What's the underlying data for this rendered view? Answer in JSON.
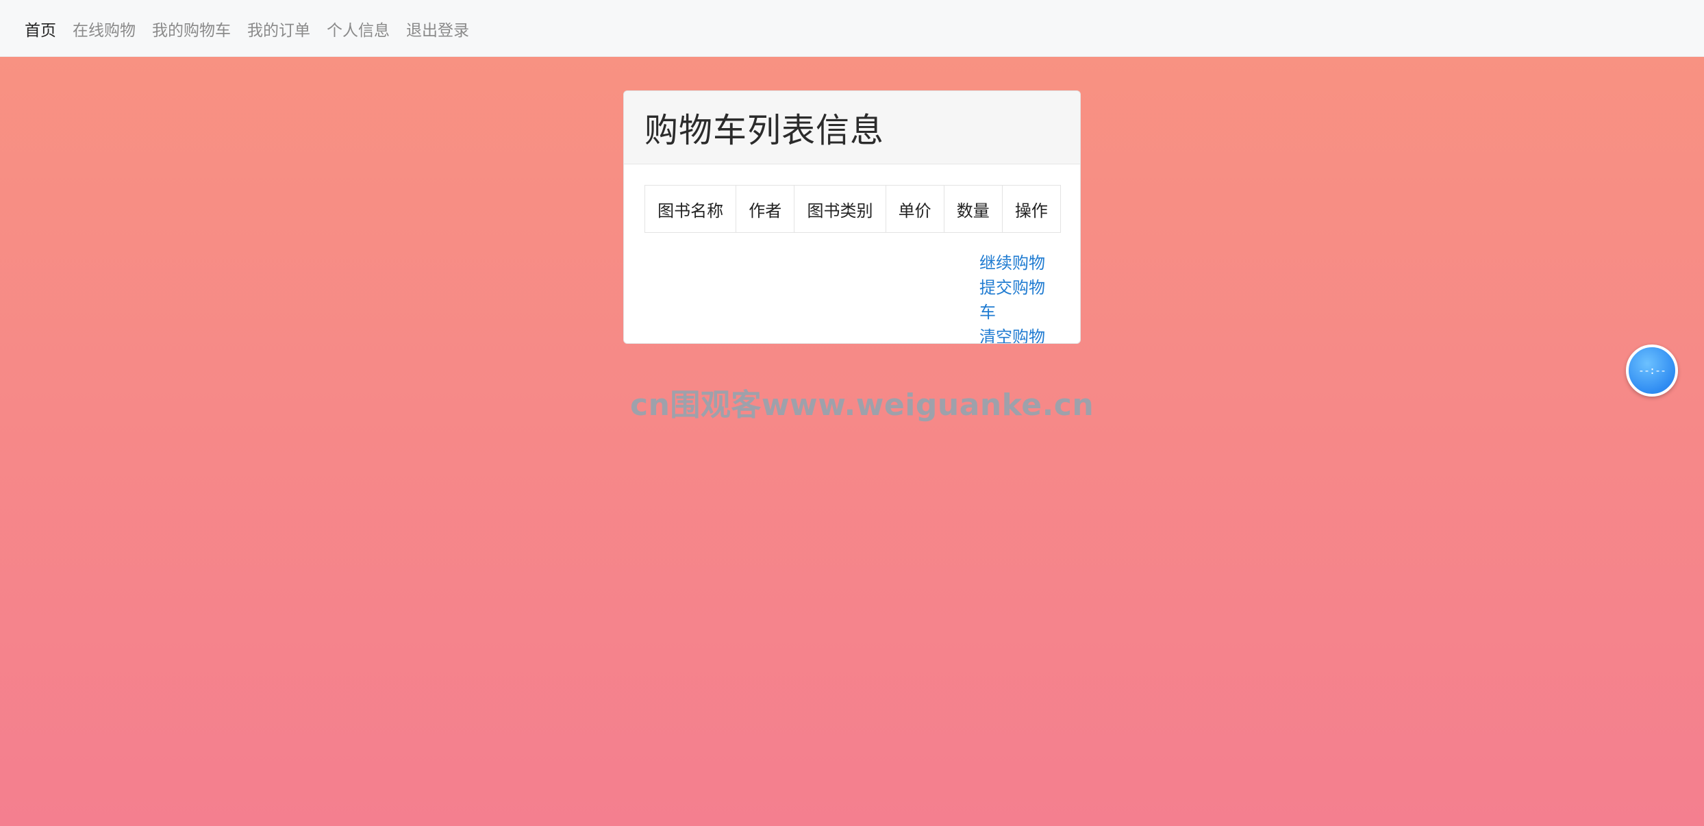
{
  "nav": {
    "items": [
      {
        "label": "首页",
        "active": true
      },
      {
        "label": "在线购物",
        "active": false
      },
      {
        "label": "我的购物车",
        "active": false
      },
      {
        "label": "我的订单",
        "active": false
      },
      {
        "label": "个人信息",
        "active": false
      },
      {
        "label": "退出登录",
        "active": false
      }
    ]
  },
  "card": {
    "title": "购物车列表信息",
    "table": {
      "columns": [
        "图书名称",
        "作者",
        "图书类别",
        "单价",
        "数量",
        "操作"
      ],
      "rows": []
    },
    "actions": {
      "continue_shopping": "继续购物",
      "submit_cart": "提交购物车",
      "clear_cart": "清空购物车"
    }
  },
  "watermark": "cn围观客www.weiguanke.cn",
  "float_button": {
    "text": "--:--"
  },
  "colors": {
    "link": "#1f7bd1",
    "background_top": "#f89381",
    "background_bottom": "#f47f8f",
    "float_button": "#2f8cf2"
  }
}
